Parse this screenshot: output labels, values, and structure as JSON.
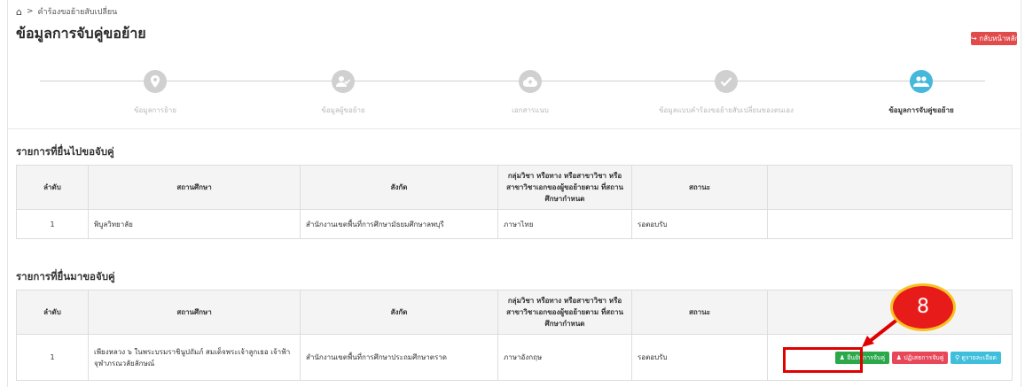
{
  "breadcrumb": {
    "home_icon": "home-icon",
    "separator": ">",
    "current": "คำร้องขอย้ายสับเปลี่ยน"
  },
  "page_title": "ข้อมูลการจับคู่ขอย้าย",
  "back_button": "↪ กลับหน้าหลัก",
  "steps": [
    {
      "label": "ข้อมูลการย้าย",
      "icon": "location-pin-icon"
    },
    {
      "label": "ข้อมูลผู้ขอย้าย",
      "icon": "user-check-icon"
    },
    {
      "label": "เอกสารแนบ",
      "icon": "cloud-upload-icon"
    },
    {
      "label": "ข้อมูลแบบคำร้องขอย้ายสับเปลี่ยนของตนเอง",
      "icon": "check-icon"
    },
    {
      "label": "ข้อมูลการจับคู่ขอย้าย",
      "icon": "users-icon"
    }
  ],
  "section1": {
    "title": "รายการที่ยื่นไปขอจับคู่",
    "headers": [
      "ลำดับ",
      "สถานศึกษา",
      "สังกัด",
      "กลุ่มวิชา หรือทาง หรือสาขาวิชา หรือสาขาวิชาเอกของผู้ขอย้ายตาม ที่สถานศึกษากำหนด",
      "สถานะ",
      ""
    ],
    "rows": [
      {
        "no": "1",
        "school": "พิบูลวิทยาลัย",
        "agency": "สำนักงานเขตพื้นที่การศึกษามัธยมศึกษาลพบุรี",
        "subject": "ภาษาไทย",
        "status": "รอตอบรับ"
      }
    ]
  },
  "section2": {
    "title": "รายการที่ยื่นมาขอจับคู่",
    "headers": [
      "ลำดับ",
      "สถานศึกษา",
      "สังกัด",
      "กลุ่มวิชา หรือทาง หรือสาขาวิชา หรือสาขาวิชาเอกของผู้ขอย้ายตาม ที่สถานศึกษากำหนด",
      "สถานะ",
      ""
    ],
    "rows": [
      {
        "no": "1",
        "school": "เพียงหลวง ๖ ในพระบรมราชินูปถัมภ์ สมเด็จพระเจ้าลูกเธอ เจ้าฟ้าจุฬาภรณวลัยลักษณ์",
        "agency": "สำนักงานเขตพื้นที่การศึกษาประถมศึกษาตราด",
        "subject": "ภาษาอังกฤษ",
        "status": "รอตอบรับ",
        "actions": {
          "confirm": "ยืนยันการจับคู่",
          "reject": "ปฏิเสธการจับคู่",
          "details": "ดูรายละเอียด"
        }
      }
    ]
  },
  "callout": {
    "number": "8"
  },
  "colors": {
    "accent": "#45b8dc",
    "danger": "#e24b4b",
    "success": "#2aa84a",
    "highlight": "#e00000",
    "badge_border": "#f7c221"
  }
}
